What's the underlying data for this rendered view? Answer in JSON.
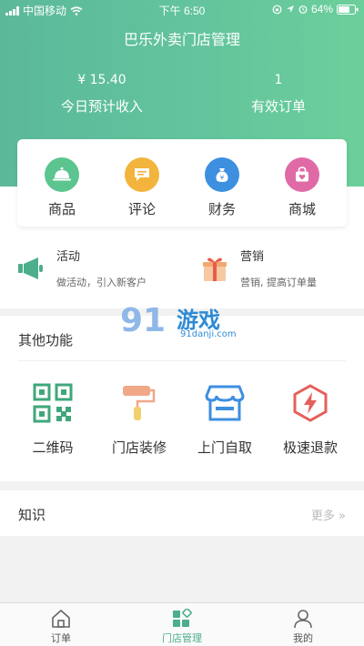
{
  "status_bar": {
    "carrier": "中国移动",
    "time": "下午 6:50",
    "battery": "64%"
  },
  "header": {
    "title": "巴乐外卖门店管理",
    "income_value": "¥ 15.40",
    "income_label": "今日预计收入",
    "orders_value": "1",
    "orders_label": "有效订单"
  },
  "quick_menu": [
    {
      "label": "商品",
      "icon": "cloche-icon",
      "color": "#5cc48f"
    },
    {
      "label": "评论",
      "icon": "comment-icon",
      "color": "#f2b43c"
    },
    {
      "label": "财务",
      "icon": "money-bag-icon",
      "color": "#3d8fe0"
    },
    {
      "label": "商城",
      "icon": "shopping-bag-icon",
      "color": "#e06aa6"
    }
  ],
  "promos": [
    {
      "title": "活动",
      "subtitle": "做活动，引入新客户",
      "icon": "megaphone-icon"
    },
    {
      "title": "营销",
      "subtitle": "营销, 提高订单量",
      "icon": "gift-icon"
    }
  ],
  "other_functions": {
    "heading": "其他功能",
    "items": [
      {
        "label": "二维码",
        "icon": "qr-code-icon"
      },
      {
        "label": "门店装修",
        "icon": "paint-roller-icon"
      },
      {
        "label": "上门自取",
        "icon": "storefront-icon"
      },
      {
        "label": "极速退款",
        "icon": "lightning-hexagon-icon"
      }
    ]
  },
  "knowledge": {
    "heading": "知识",
    "more": "更多 »"
  },
  "watermark": {
    "big": "91",
    "name": "游戏",
    "url": "91danji.com"
  },
  "tabbar": [
    {
      "label": "订单",
      "icon": "home-icon"
    },
    {
      "label": "门店管理",
      "icon": "grid-icon"
    },
    {
      "label": "我的",
      "icon": "person-icon"
    }
  ],
  "colors": {
    "brand_green": "#5bb99a",
    "active_tab": "#4cae8a"
  }
}
